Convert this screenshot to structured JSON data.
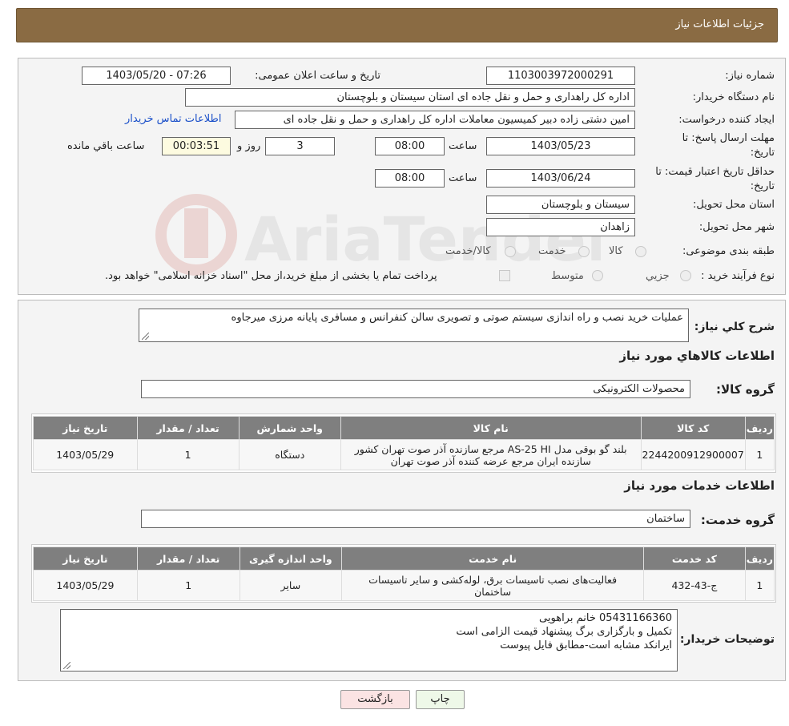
{
  "header": {
    "title": "جزئیات اطلاعات نیاز"
  },
  "form": {
    "need_number_label": "شماره نیاز:",
    "need_number": "1103003972000291",
    "announce_label": "تاریخ و ساعت اعلان عمومی:",
    "announce_value": "1403/05/20 - 07:26",
    "buyer_org_label": "نام دستگاه خریدار:",
    "buyer_org": "اداره کل راهداری و حمل و نقل جاده ای استان سیستان و بلوچستان",
    "requester_label": "ایجاد کننده درخواست:",
    "requester": "امین دشتی زاده دبیر کمیسیون معاملات اداره کل راهداری و حمل و نقل جاده ای",
    "contact_link": "اطلاعات تماس خریدار",
    "deadline_label_line1": "مهلت ارسال پاسخ: تا",
    "deadline_label_line2": "تاریخ:",
    "deadline_date": "1403/05/23",
    "time_label": "ساعت",
    "deadline_time": "08:00",
    "days_value": "3",
    "days_label": "روز و",
    "remaining_value": "00:03:51",
    "remaining_label": "ساعت باقي مانده",
    "validity_label_line1": "حداقل تاریخ اعتبار قیمت: تا",
    "validity_label_line2": "تاریخ:",
    "validity_date": "1403/06/24",
    "validity_time": "08:00",
    "province_label": "استان محل تحویل:",
    "province": "سیستان و بلوچستان",
    "city_label": "شهر محل تحویل:",
    "city": "زاهدان",
    "category_label": "طبقه بندی موضوعی:",
    "category_options": [
      "کالا",
      "خدمت",
      "کالا/خدمت"
    ],
    "process_label": "نوع فرآیند خرید :",
    "process_options": [
      "جزیي",
      "متوسط"
    ],
    "payment_note": "پرداخت تمام یا بخشی از مبلغ خرید،از محل \"اسناد خزانه اسلامی\" خواهد بود."
  },
  "description": {
    "label": "شرح کلي نیاز:",
    "value": "عملیات خرید نصب و راه اندازی سیستم صوتی و تصویری سالن کنفرانس و مسافری پایانه مرزی میرجاوه"
  },
  "goods": {
    "section_title": "اطلاعات کالاهاي مورد نیاز",
    "group_label": "گروه کالا:",
    "group_value": "محصولات الکترونیکی",
    "columns": [
      "ردیف",
      "کد کالا",
      "نام کالا",
      "واحد شمارش",
      "تعداد / مقدار",
      "تاریخ نیاز"
    ],
    "rows": [
      {
        "row": "1",
        "code": "2244200912900007",
        "name_line1": "بلند گو بوقی مدل AS-25 HI مرجع سازنده آذر صوت تهران کشور",
        "name_line2": "سازنده ایران مرجع عرضه کننده آذر صوت تهران",
        "unit": "دستگاه",
        "qty": "1",
        "date": "1403/05/29"
      }
    ]
  },
  "services": {
    "section_title": "اطلاعات خدمات مورد نیاز",
    "group_label": "گروه خدمت:",
    "group_value": "ساختمان",
    "columns": [
      "ردیف",
      "کد خدمت",
      "نام خدمت",
      "واحد اندازه گیری",
      "تعداد / مقدار",
      "تاریخ نیاز"
    ],
    "rows": [
      {
        "row": "1",
        "code": "ج-43-432",
        "name_line1": "فعالیت‌های نصب تاسیسات برق، لوله‌کشی و سایر تاسیسات",
        "name_line2": "ساختمان",
        "unit": "سایر",
        "qty": "1",
        "date": "1403/05/29"
      }
    ]
  },
  "buyer_notes": {
    "label": "توضیحات خریدار:",
    "line1": "05431166360 خانم براهویی",
    "line2": "تکمیل و بارگزاری برگ پیشنهاد قیمت الزامی است",
    "line3": "ایرانکد مشابه است-مطابق فایل پیوست"
  },
  "buttons": {
    "print": "چاپ",
    "back": "بازگشت"
  },
  "watermark": {
    "text": "AriaTender.neT"
  },
  "colors": {
    "header": "#8a6b43",
    "print_button": "#eef8e8",
    "back_button": "#fbe3e3",
    "link": "#1a4fc9"
  }
}
